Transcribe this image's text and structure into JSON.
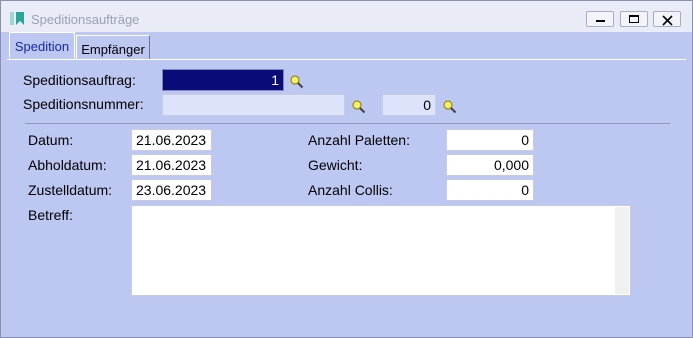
{
  "window": {
    "title": "Speditionsaufträge",
    "buttons": [
      "minimize-icon",
      "maximize-icon",
      "close-icon"
    ]
  },
  "tabs": [
    {
      "label": "Spedition",
      "active": true
    },
    {
      "label": "Empfänger",
      "active": false
    }
  ],
  "form": {
    "speditionsauftrag_label": "Speditionsauftrag:",
    "speditionsauftrag_value": "1",
    "speditionsnummer_label": "Speditionsnummer:",
    "speditionsnummer_value": "",
    "speditionsnummer_count": "0",
    "datum_label": "Datum:",
    "datum_value": "21.06.2023",
    "abholdatum_label": "Abholdatum:",
    "abholdatum_value": "21.06.2023",
    "zustelldatum_label": "Zustelldatum:",
    "zustelldatum_value": "23.06.2023",
    "anzahl_paletten_label": "Anzahl Paletten:",
    "anzahl_paletten_value": "0",
    "gewicht_label": "Gewicht:",
    "gewicht_value": "0,000",
    "anzahl_collis_label": "Anzahl Collis:",
    "anzahl_collis_value": "0",
    "betreff_label": "Betreff:",
    "betreff_value": ""
  },
  "colors": {
    "background": "#bcc7f2",
    "selected_field": "#0a0a78",
    "tab_active_text": "#1a2aa0"
  }
}
